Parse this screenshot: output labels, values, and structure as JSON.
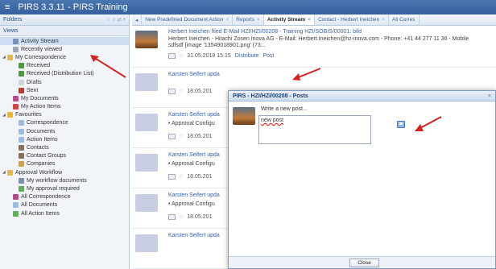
{
  "app": {
    "menu_glyph": "≡",
    "title": "PIRS 3.3.11  -  PIRS Training"
  },
  "sidebar": {
    "folders_label": "Folders",
    "views_label": "Views",
    "items": [
      {
        "label": "Activity Stream",
        "icon": "activity-stream-icon",
        "color": "#7a8fb5",
        "indent": 1,
        "selected": true
      },
      {
        "label": "Recently viewed",
        "icon": "clock-icon",
        "color": "#9aa6b5",
        "indent": 1
      },
      {
        "label": "My Correspondence",
        "icon": "folder-icon",
        "color": "#e6b84a",
        "indent": 0,
        "expander": "◢"
      },
      {
        "label": "Received",
        "icon": "inbox-icon",
        "color": "#4c9a3c",
        "indent": 2
      },
      {
        "label": "Received (Distribution List)",
        "icon": "inbox-icon",
        "color": "#4c9a3c",
        "indent": 2
      },
      {
        "label": "Drafts",
        "icon": "draft-icon",
        "color": "#c9d3df",
        "indent": 2
      },
      {
        "label": "Sent",
        "icon": "sent-icon",
        "color": "#c0392b",
        "indent": 2
      },
      {
        "label": "My Documents",
        "icon": "documents-icon",
        "color": "#b74a8a",
        "indent": 1
      },
      {
        "label": "My Action Items",
        "icon": "action-items-icon",
        "color": "#d24646",
        "indent": 1
      },
      {
        "label": "Favourites",
        "icon": "star-icon",
        "color": "#f0b429",
        "indent": 0,
        "expander": "◢"
      },
      {
        "label": "Correspondence",
        "icon": "correspondence-icon",
        "color": "#9bbbe0",
        "indent": 2
      },
      {
        "label": "Documents",
        "icon": "documents-icon",
        "color": "#9bbbe0",
        "indent": 2
      },
      {
        "label": "Action Items",
        "icon": "action-items-icon",
        "color": "#9bbbe0",
        "indent": 2
      },
      {
        "label": "Contacts",
        "icon": "contacts-icon",
        "color": "#8b6f5a",
        "indent": 2
      },
      {
        "label": "Contact Groups",
        "icon": "contact-groups-icon",
        "color": "#8b6f5a",
        "indent": 2
      },
      {
        "label": "Companies",
        "icon": "companies-icon",
        "color": "#d0a24a",
        "indent": 2
      },
      {
        "label": "Approval Workflow",
        "icon": "folder-icon",
        "color": "#e6b84a",
        "indent": 0,
        "expander": "◢"
      },
      {
        "label": "My workflow documents",
        "icon": "workflow-icon",
        "color": "#7a8fb5",
        "indent": 2
      },
      {
        "label": "My approval required",
        "icon": "approval-icon",
        "color": "#5fae5a",
        "indent": 2
      },
      {
        "label": "All Correspondence",
        "icon": "correspondence-icon",
        "color": "#b74a8a",
        "indent": 1
      },
      {
        "label": "All Documents",
        "icon": "documents-icon",
        "color": "#9bbbe0",
        "indent": 1
      },
      {
        "label": "All Action Items",
        "icon": "action-items-icon",
        "color": "#5fae5a",
        "indent": 1
      }
    ]
  },
  "tabs": [
    {
      "label": "New Predefined Document Action",
      "active": false
    },
    {
      "label": "Reports",
      "active": false
    },
    {
      "label": "Activity Stream",
      "active": true
    },
    {
      "label": "Contact - Herbert Ineichen",
      "active": false
    },
    {
      "label": "All Corres",
      "active": false
    }
  ],
  "feed": {
    "first_post": {
      "author_line": "Herbert Ineichen filed E-Mail HZI/HZI/00208 - Training HZI/SOBIS/00001: bild",
      "detail_line_1": "Herbert Ineichen - Hitachi Zosen Inova AG - E-Mail: Herbert.Ineichen@hz-inova.com - Phone: +41 44 277 11 36 - Mobile",
      "detail_line_2": "sdfsdf [image '13549018901.png' (73...",
      "date": "31.05.2018 15:15",
      "distribute_label": "Distribute",
      "post_label": "Post"
    },
    "posts": [
      {
        "author": "Karsten Seifert upda",
        "date": "18.05.201",
        "subline": ""
      },
      {
        "author": "Karsten Seifert upda",
        "date": "18.05.201",
        "subline": "Approval Configu"
      },
      {
        "author": "Karsten Seifert upda",
        "date": "18.05.201",
        "subline": "Approval Configu"
      },
      {
        "author": "Karsten Seifert upda",
        "date": "18.05.201",
        "subline": "Approval Configu"
      },
      {
        "author": "Karsten Seifert upda",
        "date": "",
        "subline": ""
      }
    ]
  },
  "dialog": {
    "title": "PIRS - HZI/HZI/00208 - Posts",
    "close_glyph": "×",
    "prompt": "Write a new post...",
    "input_value": "new post",
    "close_button_label": "Close"
  },
  "colors": {
    "accent": "#35609c",
    "arrow": "#d42222",
    "link": "#3b63a8"
  }
}
